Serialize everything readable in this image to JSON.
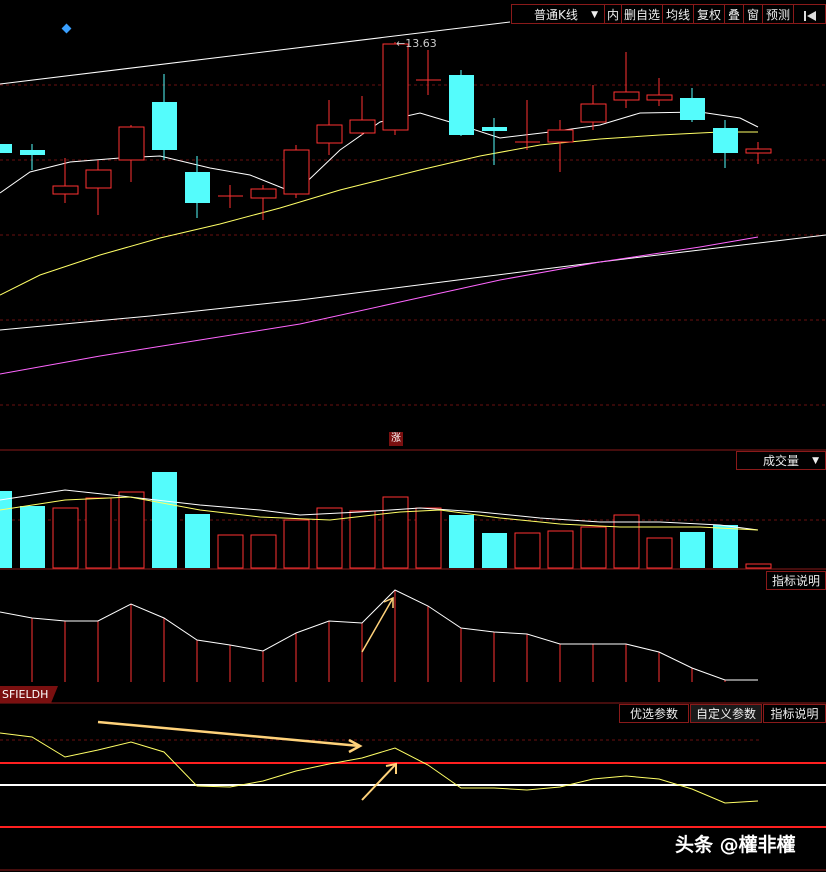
{
  "toolbar": {
    "kline_type": "普通K线",
    "arrow": "▼",
    "items": [
      "内",
      "删自选",
      "均线",
      "复权",
      "叠",
      "窗",
      "预测"
    ],
    "nav_icon": "first-page-icon"
  },
  "price_label": "←13.63",
  "zhang_label": "涨",
  "volume_panel": {
    "select_label": "成交量",
    "select_arrow": "▼"
  },
  "indicator_panel": {
    "explain_label": "指标说明"
  },
  "sfield_panel": {
    "name": "SFIELDH",
    "tabs": [
      "优选参数",
      "自定义参数",
      "指标说明"
    ]
  },
  "watermark": "头条 @權非權",
  "colors": {
    "up": "#ff3232",
    "down": "#54fcfc",
    "ma_white": "#ffffff",
    "ma_yellow": "#ffff66",
    "ma_magenta": "#ff66ff",
    "annotation": "#ffd27a"
  }
}
